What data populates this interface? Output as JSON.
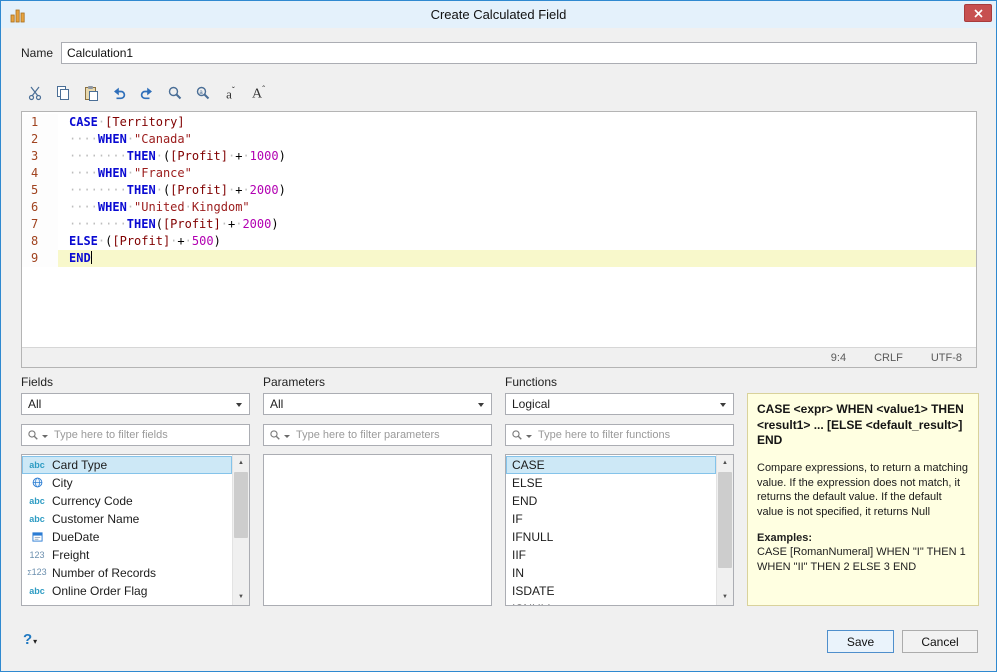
{
  "window": {
    "title": "Create Calculated Field"
  },
  "name_field": {
    "label": "Name",
    "value": "Calculation1"
  },
  "toolbar": {
    "buttons": [
      "cut",
      "copy",
      "paste",
      "undo",
      "redo",
      "find",
      "replace",
      "font-decrease",
      "font-increase"
    ]
  },
  "editor": {
    "lines": [
      {
        "segments": [
          {
            "c": "kw",
            "t": "CASE"
          },
          {
            "c": "ws",
            "t": "·"
          },
          {
            "c": "fld",
            "t": "[Territory]"
          }
        ]
      },
      {
        "segments": [
          {
            "c": "ws",
            "t": "····"
          },
          {
            "c": "kw",
            "t": "WHEN"
          },
          {
            "c": "ws",
            "t": "·"
          },
          {
            "c": "str",
            "t": "\"Canada\""
          }
        ]
      },
      {
        "segments": [
          {
            "c": "ws",
            "t": "········"
          },
          {
            "c": "kw",
            "t": "THEN"
          },
          {
            "c": "ws",
            "t": "·"
          },
          {
            "c": "pln",
            "t": "("
          },
          {
            "c": "fld",
            "t": "[Profit]"
          },
          {
            "c": "ws",
            "t": "·"
          },
          {
            "c": "pln",
            "t": "+"
          },
          {
            "c": "ws",
            "t": "·"
          },
          {
            "c": "num",
            "t": "1000"
          },
          {
            "c": "pln",
            "t": ")"
          }
        ]
      },
      {
        "segments": [
          {
            "c": "ws",
            "t": "····"
          },
          {
            "c": "kw",
            "t": "WHEN"
          },
          {
            "c": "ws",
            "t": "·"
          },
          {
            "c": "str",
            "t": "\"France\""
          }
        ]
      },
      {
        "segments": [
          {
            "c": "ws",
            "t": "········"
          },
          {
            "c": "kw",
            "t": "THEN"
          },
          {
            "c": "ws",
            "t": "·"
          },
          {
            "c": "pln",
            "t": "("
          },
          {
            "c": "fld",
            "t": "[Profit]"
          },
          {
            "c": "ws",
            "t": "·"
          },
          {
            "c": "pln",
            "t": "+"
          },
          {
            "c": "ws",
            "t": "·"
          },
          {
            "c": "num",
            "t": "2000"
          },
          {
            "c": "pln",
            "t": ")"
          }
        ]
      },
      {
        "segments": [
          {
            "c": "ws",
            "t": "····"
          },
          {
            "c": "kw",
            "t": "WHEN"
          },
          {
            "c": "ws",
            "t": "·"
          },
          {
            "c": "str",
            "t": "\"United"
          },
          {
            "c": "ws",
            "t": "·"
          },
          {
            "c": "str",
            "t": "Kingdom\""
          }
        ]
      },
      {
        "segments": [
          {
            "c": "ws",
            "t": "········"
          },
          {
            "c": "kw",
            "t": "THEN"
          },
          {
            "c": "pln",
            "t": "("
          },
          {
            "c": "fld",
            "t": "[Profit]"
          },
          {
            "c": "ws",
            "t": "·"
          },
          {
            "c": "pln",
            "t": "+"
          },
          {
            "c": "ws",
            "t": "·"
          },
          {
            "c": "num",
            "t": "2000"
          },
          {
            "c": "pln",
            "t": ")"
          }
        ]
      },
      {
        "segments": [
          {
            "c": "kw",
            "t": "ELSE"
          },
          {
            "c": "ws",
            "t": "·"
          },
          {
            "c": "pln",
            "t": "("
          },
          {
            "c": "fld",
            "t": "[Profit]"
          },
          {
            "c": "ws",
            "t": "·"
          },
          {
            "c": "pln",
            "t": "+"
          },
          {
            "c": "ws",
            "t": "·"
          },
          {
            "c": "num",
            "t": "500"
          },
          {
            "c": "pln",
            "t": ")"
          }
        ]
      },
      {
        "current": true,
        "segments": [
          {
            "c": "kw",
            "t": "END"
          }
        ]
      }
    ],
    "status": {
      "caret": "9:4",
      "line_ending": "CRLF",
      "encoding": "UTF-8"
    }
  },
  "fields_panel": {
    "label": "Fields",
    "dropdown": "All",
    "filter_placeholder": "Type here to filter fields",
    "items": [
      {
        "icon": "abc",
        "label": "Card Type",
        "selected": true
      },
      {
        "icon": "globe",
        "label": "City"
      },
      {
        "icon": "abc",
        "label": "Currency Code"
      },
      {
        "icon": "abc",
        "label": "Customer Name"
      },
      {
        "icon": "calendar",
        "label": "DueDate"
      },
      {
        "icon": "123",
        "label": "Freight"
      },
      {
        "icon": "num-records",
        "label": "Number of Records"
      },
      {
        "icon": "abc",
        "label": "Online Order Flag"
      }
    ]
  },
  "parameters_panel": {
    "label": "Parameters",
    "dropdown": "All",
    "filter_placeholder": "Type here to filter parameters",
    "items": []
  },
  "functions_panel": {
    "label": "Functions",
    "dropdown": "Logical",
    "filter_placeholder": "Type here to filter functions",
    "items": [
      {
        "label": "CASE",
        "selected": true
      },
      {
        "label": "ELSE"
      },
      {
        "label": "END"
      },
      {
        "label": "IF"
      },
      {
        "label": "IFNULL"
      },
      {
        "label": "IIF"
      },
      {
        "label": "IN"
      },
      {
        "label": "ISDATE"
      },
      {
        "label": "ISNULL"
      }
    ]
  },
  "description": {
    "signature": "CASE <expr> WHEN <value1> THEN <result1> ... [ELSE <default_result>] END",
    "body": "Compare expressions, to return a matching value. If the expression does not match, it returns the default value. If the default value is not specified, it returns Null",
    "examples_label": "Examples:",
    "example": "CASE [RomanNumeral] WHEN \"I\" THEN 1 WHEN \"II\" THEN 2 ELSE 3 END"
  },
  "footer": {
    "help": "?",
    "save": "Save",
    "cancel": "Cancel"
  }
}
